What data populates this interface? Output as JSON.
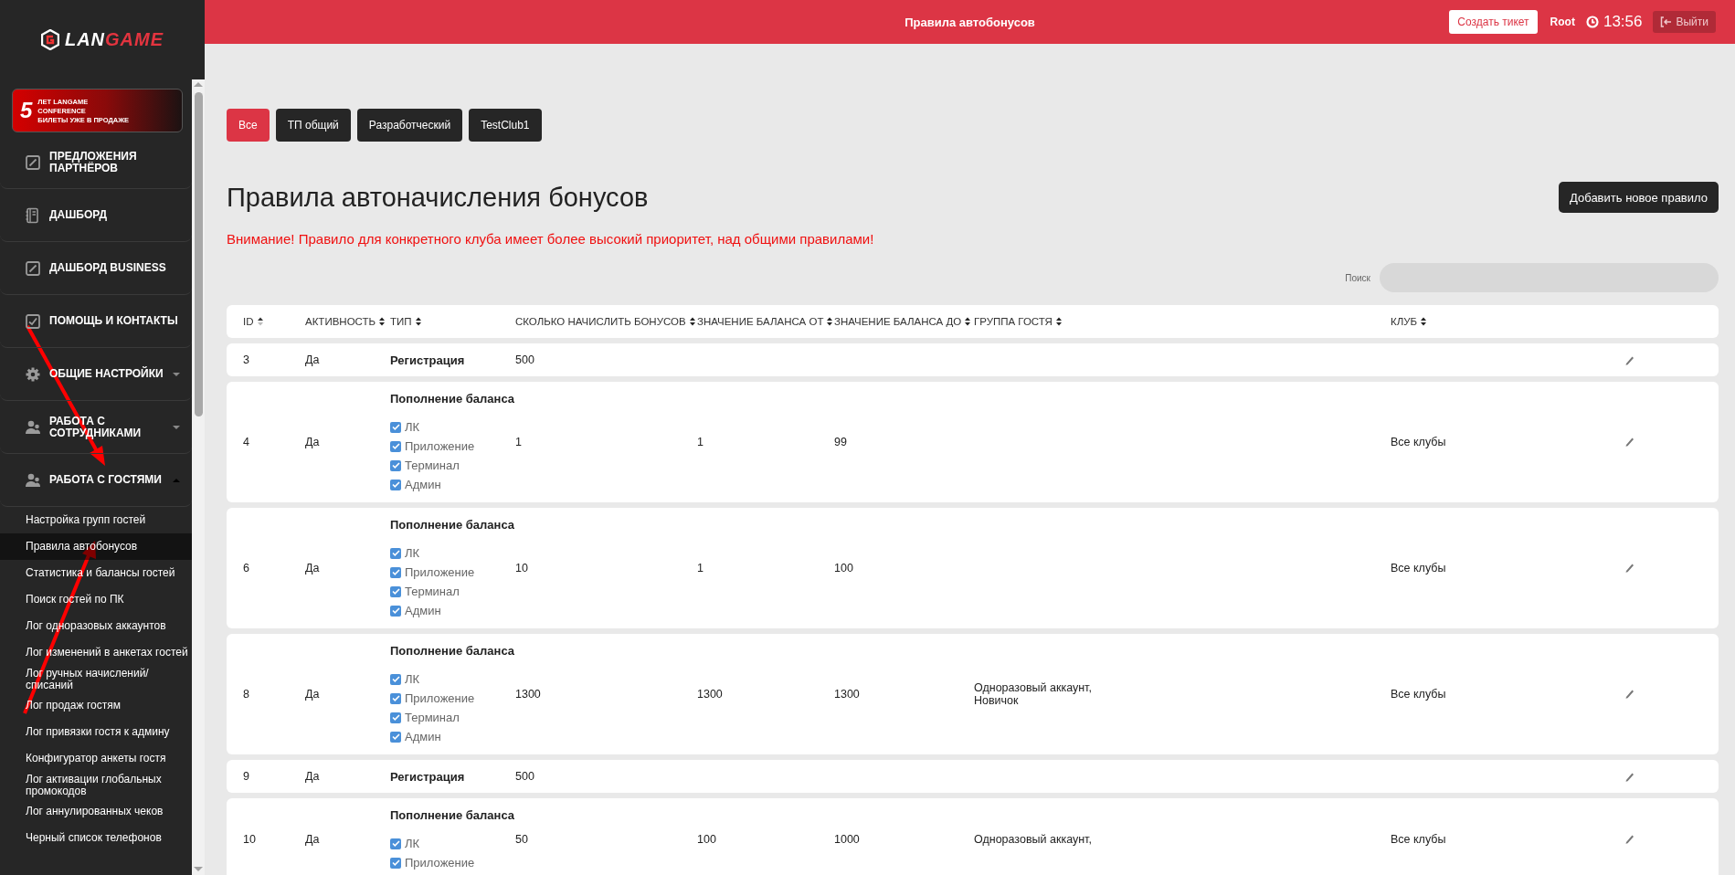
{
  "sidebar": {
    "logo": {
      "text_1": "LAN",
      "text_2": "GAME"
    },
    "banner": {
      "number": "5",
      "line_1": "ЛЕТ LANGAME",
      "line_2": "CONFERENCE",
      "line_3": "БИЛЕТЫ УЖЕ В ПРОДАЖЕ"
    },
    "items": [
      {
        "label": "ПРЕДЛОЖЕНИЯ ПАРТНЁРОВ"
      },
      {
        "label": "ДАШБОРД"
      },
      {
        "label": "ДАШБОРД BUSINESS"
      },
      {
        "label": "ПОМОЩЬ И КОНТАКТЫ"
      },
      {
        "label": "ОБЩИЕ НАСТРОЙКИ",
        "expanded": false
      },
      {
        "label": "РАБОТА С СОТРУДНИКАМИ",
        "expanded": false
      },
      {
        "label": "РАБОТА С ГОСТЯМИ",
        "expanded": true,
        "children": [
          {
            "label": "Настройка групп гостей",
            "selected": false
          },
          {
            "label": "Правила автобонусов",
            "selected": true
          },
          {
            "label": "Статистика и балансы гостей",
            "selected": false
          },
          {
            "label": "Поиск гостей по ПК",
            "selected": false
          },
          {
            "label": "Лог одноразовых аккаунтов",
            "selected": false
          },
          {
            "label": "Лог изменений в анкетах гостей",
            "selected": false
          },
          {
            "label": "Лог ручных начислений/списаний",
            "selected": false
          },
          {
            "label": "Лог продаж гостям",
            "selected": false
          },
          {
            "label": "Лог привязки гостя к админу",
            "selected": false
          },
          {
            "label": "Конфигуратор анкеты гостя",
            "selected": false
          },
          {
            "label": "Лог активации глобальных промокодов",
            "selected": false
          },
          {
            "label": "Лог аннулированных чеков",
            "selected": false
          },
          {
            "label": "Черный список телефонов",
            "selected": false
          }
        ]
      }
    ]
  },
  "header": {
    "title": "Правила автобонусов",
    "create_ticket": "Создать тикет",
    "user": "Root",
    "time": "13:56",
    "logout": "Выйти"
  },
  "filters": [
    {
      "label": "Все",
      "selected": true
    },
    {
      "label": "ТП общий",
      "selected": false
    },
    {
      "label": "Разработческий",
      "selected": false
    },
    {
      "label": "TestClub1",
      "selected": false
    }
  ],
  "page": {
    "title": "Правила автоначисления бонусов",
    "add_button": "Добавить новое правило",
    "warning": "Внимание! Правило для конкретного клуба имеет более высокий приоритет, над общими правилами!",
    "search_label": "Поиск"
  },
  "table": {
    "columns": [
      {
        "label": "ID",
        "sorted": true
      },
      {
        "label": "АКТИВНОСТЬ",
        "sorted": false
      },
      {
        "label": "ТИП",
        "sorted": false
      },
      {
        "label": "СКОЛЬКО НАЧИСЛИТЬ БОНУСОВ",
        "sorted": false
      },
      {
        "label": "ЗНАЧЕНИЕ БАЛАНСА ОТ",
        "sorted": false
      },
      {
        "label": "ЗНАЧЕНИЕ БАЛАНСА ДО",
        "sorted": false
      },
      {
        "label": "ГРУППА ГОСТЯ",
        "sorted": false
      },
      {
        "label": "КЛУБ",
        "sorted": false
      }
    ],
    "rows": [
      {
        "id": "3",
        "active": "Да",
        "type": {
          "kind": "plain",
          "title": "Регистрация"
        },
        "bonus": "500"
      },
      {
        "id": "4",
        "active": "Да",
        "type": {
          "kind": "sources",
          "title": "Пополнение баланса",
          "sources": [
            {
              "label": "ЛК",
              "checked": true
            },
            {
              "label": "Приложение",
              "checked": true
            },
            {
              "label": "Терминал",
              "checked": true
            },
            {
              "label": "Админ",
              "checked": true
            }
          ]
        },
        "bonus": "1",
        "from": "1",
        "to": "99",
        "club": "Все клубы"
      },
      {
        "id": "6",
        "active": "Да",
        "type": {
          "kind": "sources",
          "title": "Пополнение баланса",
          "sources": [
            {
              "label": "ЛК",
              "checked": true
            },
            {
              "label": "Приложение",
              "checked": true
            },
            {
              "label": "Терминал",
              "checked": true
            },
            {
              "label": "Админ",
              "checked": true
            }
          ]
        },
        "bonus": "10",
        "from": "1",
        "to": "100",
        "club": "Все клубы"
      },
      {
        "id": "8",
        "active": "Да",
        "type": {
          "kind": "sources",
          "title": "Пополнение баланса",
          "sources": [
            {
              "label": "ЛК",
              "checked": true
            },
            {
              "label": "Приложение",
              "checked": true
            },
            {
              "label": "Терминал",
              "checked": true
            },
            {
              "label": "Админ",
              "checked": true
            }
          ]
        },
        "bonus": "1300",
        "from": "1300",
        "to": "1300",
        "group": [
          "Одноразовый аккаунт,",
          "Новичок"
        ],
        "club": "Все клубы"
      },
      {
        "id": "9",
        "active": "Да",
        "type": {
          "kind": "plain",
          "title": "Регистрация"
        },
        "bonus": "500"
      },
      {
        "id": "10",
        "active": "Да",
        "type": {
          "kind": "sources",
          "title": "Пополнение баланса",
          "sources": [
            {
              "label": "ЛК",
              "checked": true
            },
            {
              "label": "Приложение",
              "checked": true
            }
          ]
        },
        "bonus": "50",
        "from": "100",
        "to": "1000",
        "group": [
          "Одноразовый аккаунт,"
        ],
        "club": "Все клубы"
      }
    ]
  }
}
